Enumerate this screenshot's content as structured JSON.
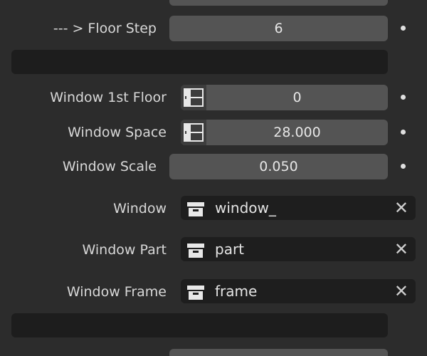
{
  "rows": {
    "floor_step": {
      "label": "--- > Floor Step",
      "value": "6"
    },
    "window_1st_floor": {
      "label": "Window 1st Floor",
      "value": "0"
    },
    "window_space": {
      "label": "Window Space",
      "value": "28.000"
    },
    "window_scale": {
      "label": "Window Scale",
      "value": "0.050"
    },
    "window": {
      "label": "Window",
      "value": "window_"
    },
    "window_part": {
      "label": "Window Part",
      "value": "part"
    },
    "window_frame": {
      "label": "Window Frame",
      "value": "frame"
    }
  },
  "icons": {
    "toggle": "toggle-grid-icon",
    "object": "box-icon",
    "clear": "close-icon"
  },
  "colors": {
    "background": "#2c2c2c",
    "field": "#545454",
    "dark_field": "#1e1e1e",
    "text": "#dcdcdc"
  }
}
